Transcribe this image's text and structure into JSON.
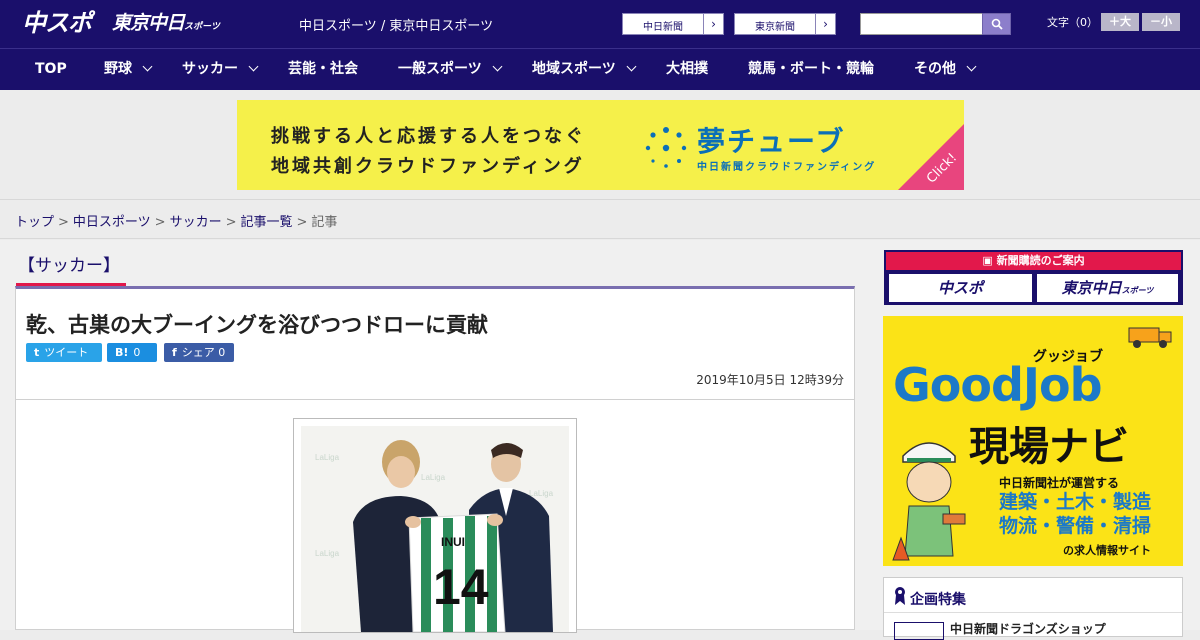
{
  "header": {
    "logo_chuspo": "中スポ",
    "logo_tokyo": "東京中日",
    "logo_tokyo_small": "スポーツ",
    "site_links": "中日スポーツ / 東京中日スポーツ",
    "btn_chunichi": "中日新聞",
    "btn_tokyo": "東京新聞",
    "search_placeholder": "",
    "fontsize_label": "文字（0）",
    "fontsize_up": "＋大",
    "fontsize_down": "－小"
  },
  "nav": {
    "items": [
      {
        "label": "TOP",
        "dropdown": false
      },
      {
        "label": "野球",
        "dropdown": true
      },
      {
        "label": "サッカー",
        "dropdown": true
      },
      {
        "label": "芸能・社会",
        "dropdown": false
      },
      {
        "label": "一般スポーツ",
        "dropdown": true
      },
      {
        "label": "地域スポーツ",
        "dropdown": true
      },
      {
        "label": "大相撲",
        "dropdown": false
      },
      {
        "label": "競馬・ボート・競輪",
        "dropdown": false
      },
      {
        "label": "その他",
        "dropdown": true
      }
    ]
  },
  "ad": {
    "line1": "挑戦する人と応援する人をつなぐ",
    "line2": "地域共創クラウドファンディング",
    "brand": "夢チューブ",
    "sub": "中日新聞クラウドファンディング",
    "click": "Click!"
  },
  "breadcrumb": {
    "items": [
      "トップ",
      "中日スポーツ",
      "サッカー",
      "記事一覧"
    ],
    "current": "記事"
  },
  "article": {
    "category": "【サッカー】",
    "title": "乾、古巣の大ブーイングを浴びつつドローに貢献",
    "share": {
      "tweet_icon": "t",
      "tweet_label": "ツイート",
      "hatena_icon": "B!",
      "hatena_count": "0",
      "fb_icon": "f",
      "fb_label": "シェア",
      "fb_count": "0"
    },
    "date": "2019年10月5日 12時39分",
    "photo": {
      "jersey_name": "INUI",
      "jersey_number": "14",
      "sponsor_logo": "LaLiga"
    }
  },
  "sidebar": {
    "subscription": {
      "header": "新聞購読のご案内",
      "btn1": "中スポ",
      "btn2": "東京中日",
      "btn2_small": "スポーツ"
    },
    "goodjob": {
      "sub": "グッジョブ",
      "brand": "GoodJob",
      "navi": "現場ナビ",
      "desc": "中日新聞社が運営する",
      "list1": "建築・土木・製造",
      "list2": "物流・警備・清掃",
      "foot": "の求人情報サイト"
    },
    "feature": {
      "title": "企画特集",
      "item1": "中日新聞ドラゴンズショップ"
    }
  },
  "colors": {
    "brand_navy": "#1a0f6b",
    "accent_red": "#e2184b",
    "ad_yellow": "#f5f04a",
    "twitter": "#2aa3e8",
    "hatena": "#1b8ee0",
    "facebook": "#3b5ca6"
  },
  "icons": {
    "search": "search-icon",
    "nav_dropdown": "chevron-down-icon",
    "feature": "ribbon-icon",
    "subscription": "newspaper-icon"
  }
}
